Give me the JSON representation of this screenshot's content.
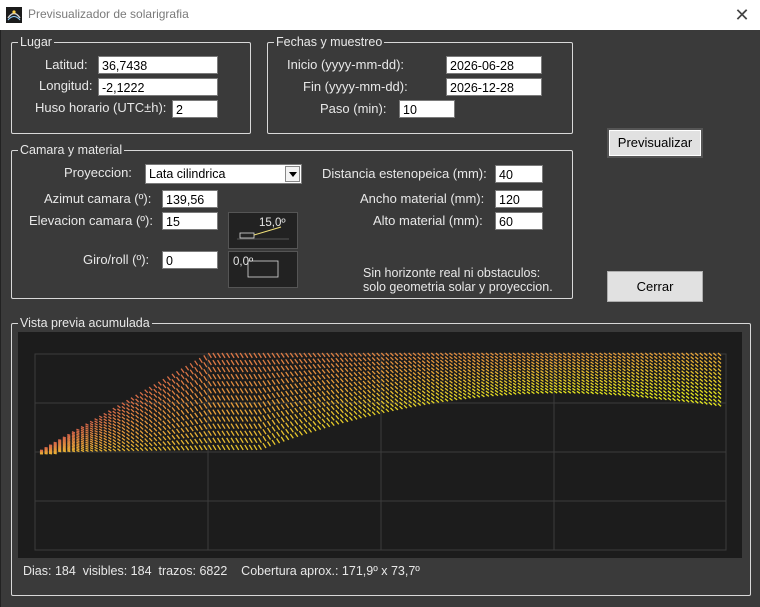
{
  "window": {
    "title": "Previsualizador de solarigrafia",
    "close_glyph": "✕",
    "icon": "solargraph-app-icon"
  },
  "lugar": {
    "legend": "Lugar",
    "latitud_label": "Latitud:",
    "latitud_value": "36,7438",
    "longitud_label": "Longitud:",
    "longitud_value": "-2,1222",
    "huso_label": "Huso horario (UTC±h):",
    "huso_value": "2"
  },
  "fechas": {
    "legend": "Fechas y muestreo",
    "inicio_label": "Inicio (yyyy-mm-dd):",
    "inicio_value": "2026-06-28",
    "fin_label": "Fin (yyyy-mm-dd):",
    "fin_value": "2026-12-28",
    "paso_label": "Paso (min):",
    "paso_value": "10"
  },
  "camara": {
    "legend": "Camara y material",
    "proyeccion_label": "Proyeccion:",
    "proyeccion_value": "Lata cilindrica",
    "azimut_label": "Azimut camara (º):",
    "azimut_value": "139,56",
    "elevacion_label": "Elevacion camara (º):",
    "elevacion_value": "15",
    "giro_label": "Giro/roll (º):",
    "giro_value": "0",
    "elevacion_dial": "15,0º",
    "giro_dial": "0,0º",
    "distancia_label": "Distancia estenopeica (mm):",
    "distancia_value": "40",
    "ancho_label": "Ancho material (mm):",
    "ancho_value": "120",
    "alto_label": "Alto material (mm):",
    "alto_value": "60",
    "note_line1": "Sin horizonte real ni obstaculos:",
    "note_line2": "solo geometria solar y proyeccion."
  },
  "buttons": {
    "previsualizar": "Previsualizar",
    "cerrar": "Cerrar"
  },
  "preview": {
    "legend": "Vista previa acumulada",
    "status": "Dias: 184  visibles: 184  trazos: 6822    Cobertura aprox.: 171,9º x 73,7º",
    "colors": {
      "start": "#d4614a",
      "mid": "#e8a23a",
      "end": "#e6e81e",
      "background": "#1c1c1c",
      "grid": "#3c3c3c"
    }
  }
}
